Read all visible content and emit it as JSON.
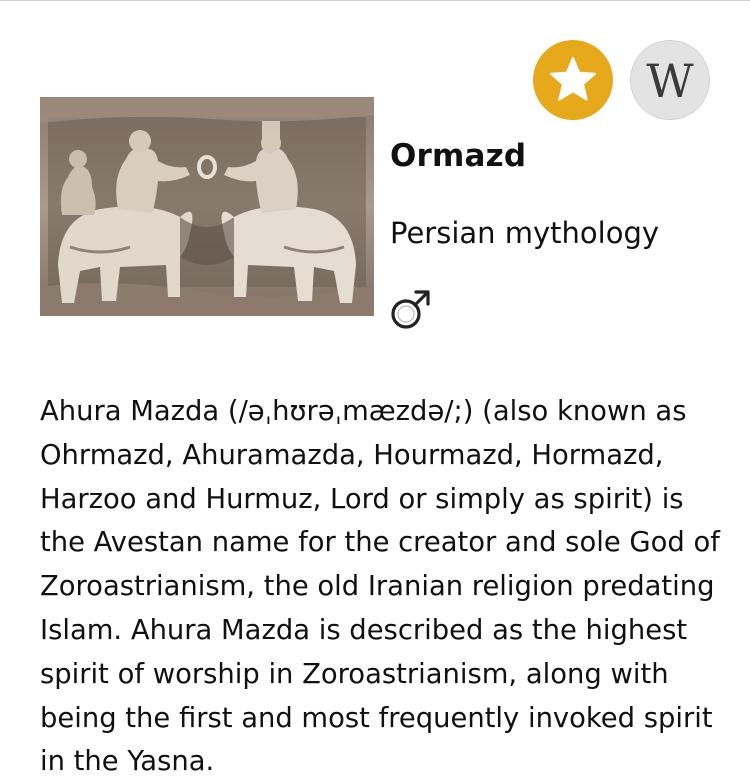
{
  "header": {
    "favorite_icon": "star-icon",
    "wikipedia_icon": "wikipedia-w-icon",
    "wikipedia_glyph": "W",
    "favorite_color": "#E7A91C",
    "wikipedia_color": "#E3E3E3"
  },
  "entry": {
    "image_subject": "rock relief carving",
    "title": "Ormazd",
    "subtitle": "Persian mythology",
    "gender_icon": "male-symbol-icon"
  },
  "description": "Ahura Mazda (/əˌhʊrəˌmæzdə/;) (also known as Ohrmazd, Ahuramazda, Hourmazd, Hormazd, Harzoo and Hurmuz, Lord or simply as spirit) is the Avestan name for the creator and sole God of Zoroastrianism, the old Iranian religion predating Islam. Ahura Mazda is described as the highest spirit of worship in Zoroastrianism, along with being the first and most frequently invoked spirit in the Yasna."
}
